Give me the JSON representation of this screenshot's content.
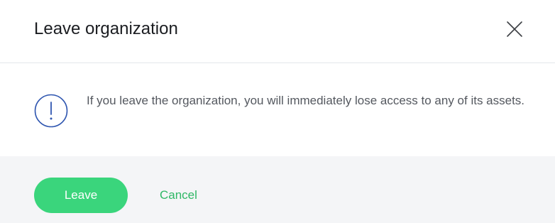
{
  "dialog": {
    "title": "Leave organization",
    "close_icon": "close-icon",
    "info_icon": "exclamation-circle-icon",
    "message": "If you leave the organization, you will immediately lose access to any of its assets.",
    "primary_button": "Leave",
    "secondary_button": "Cancel"
  },
  "colors": {
    "accent": "#3ad57c",
    "link": "#2fb866",
    "icon": "#2f56b0",
    "footer_bg": "#f4f5f7"
  }
}
